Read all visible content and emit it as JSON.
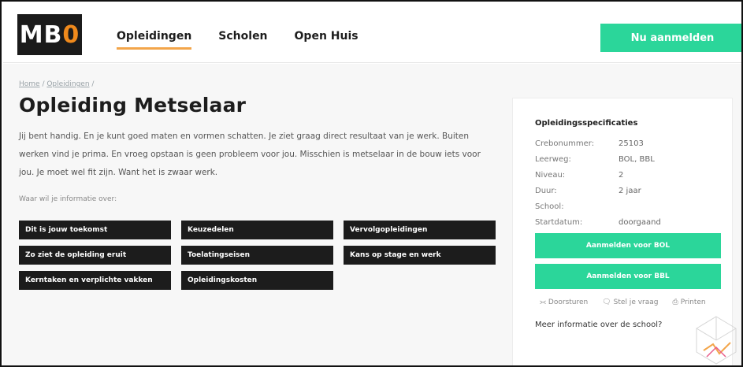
{
  "header": {
    "logo_prefix": "MB",
    "logo_o": "0",
    "nav": [
      "Opleidingen",
      "Scholen",
      "Open Huis"
    ],
    "cta": "Nu aanmelden"
  },
  "breadcrumb": {
    "home": "Home",
    "sep": " / ",
    "opleidingen": "Opleidingen",
    "trail": " /"
  },
  "page": {
    "title": "Opleiding Metselaar",
    "intro": "Jij bent handig. En je kunt goed maten en vormen schatten. Je ziet graag direct resultaat van je werk. Buiten werken vind je prima. En vroeg opstaan is geen probleem voor jou. Misschien is metselaar in de bouw iets voor jou. Je moet wel fit zijn. Want het is zwaar werk.",
    "ask": "Waar wil je informatie over:",
    "buttons": [
      "Dit is jouw toekomst",
      "Keuzedelen",
      "Vervolgopleidingen",
      "Zo ziet de opleiding eruit",
      "Toelatingseisen",
      "Kans op stage en werk",
      "Kerntaken en verplichte vakken",
      "Opleidingskosten"
    ]
  },
  "sidebar": {
    "title": "Opleidingsspecificaties",
    "specs": [
      {
        "key": "Crebonummer:",
        "value": "25103"
      },
      {
        "key": "Leerweg:",
        "value": "BOL, BBL"
      },
      {
        "key": "Niveau:",
        "value": "2"
      },
      {
        "key": "Duur:",
        "value": "2 jaar"
      },
      {
        "key": "School:",
        "value": ""
      },
      {
        "key": "Startdatum:",
        "value": "doorgaand"
      }
    ],
    "apply_bol": "Aanmelden voor BOL",
    "apply_bbl": "Aanmelden voor BBL",
    "actions": [
      "Doorsturen",
      "Stel je vraag",
      "Printen"
    ],
    "more": "Meer informatie over de school?"
  },
  "colors": {
    "accent_green": "#2bd69a",
    "nav_underline": "#f3a54a",
    "logo_orange": "#f08a1c",
    "dark_button": "#1c1c1c"
  },
  "icons": {
    "share": "share-icon",
    "chat": "chat-icon",
    "print": "printer-icon"
  }
}
